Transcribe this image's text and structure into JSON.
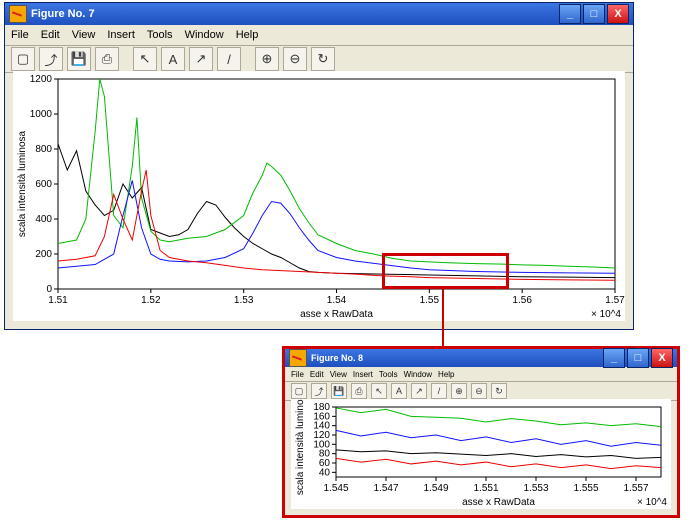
{
  "window_main": {
    "title": "Figure No. 7"
  },
  "window_zoom": {
    "title": "Figure No. 8"
  },
  "menu": {
    "file": "File",
    "edit": "Edit",
    "view": "View",
    "insert": "Insert",
    "tools": "Tools",
    "window": "Window",
    "help": "Help"
  },
  "toolbar_icons": [
    "new",
    "open",
    "save",
    "print",
    "arrow",
    "text",
    "line",
    "arrowline",
    "zoomin",
    "zoomout",
    "rotate"
  ],
  "titlebar_buttons": {
    "min": "_",
    "max": "□",
    "close": "X"
  },
  "chart_data": {
    "type": "line",
    "title": "",
    "xlabel": "asse x RawData",
    "ylabel": "scala intensità luminosa",
    "x_exponent": "× 10^4",
    "xlim": [
      1.51,
      1.57
    ],
    "ylim": [
      0,
      1200
    ],
    "xticks": [
      1.51,
      1.52,
      1.53,
      1.54,
      1.55,
      1.56,
      1.57
    ],
    "yticks": [
      0,
      200,
      400,
      600,
      800,
      1000,
      1200
    ],
    "highlight_x": [
      1.545,
      1.558
    ],
    "highlight_y": [
      30,
      200
    ],
    "series": [
      {
        "name": "black",
        "color": "#000",
        "x": [
          1.51,
          1.511,
          1.512,
          1.513,
          1.514,
          1.515,
          1.516,
          1.517,
          1.518,
          1.519,
          1.52,
          1.521,
          1.522,
          1.523,
          1.524,
          1.525,
          1.526,
          1.527,
          1.528,
          1.529,
          1.53,
          1.531,
          1.532,
          1.533,
          1.534,
          1.535,
          1.536,
          1.537,
          1.538,
          1.54,
          1.542,
          1.545,
          1.548,
          1.55,
          1.555,
          1.56,
          1.565,
          1.57
        ],
        "y": [
          830,
          680,
          790,
          560,
          480,
          420,
          450,
          600,
          520,
          580,
          340,
          320,
          300,
          310,
          340,
          430,
          500,
          480,
          410,
          350,
          300,
          260,
          230,
          200,
          180,
          150,
          120,
          100,
          95,
          90,
          88,
          85,
          82,
          80,
          75,
          70,
          68,
          65
        ]
      },
      {
        "name": "green",
        "color": "#0b0",
        "x": [
          1.51,
          1.512,
          1.513,
          1.514,
          1.5145,
          1.515,
          1.516,
          1.517,
          1.518,
          1.5185,
          1.519,
          1.52,
          1.521,
          1.522,
          1.524,
          1.526,
          1.528,
          1.53,
          1.531,
          1.532,
          1.5325,
          1.533,
          1.534,
          1.535,
          1.536,
          1.537,
          1.538,
          1.54,
          1.542,
          1.544,
          1.546,
          1.548,
          1.55,
          1.552,
          1.555,
          1.558,
          1.56,
          1.562,
          1.565,
          1.568,
          1.57
        ],
        "y": [
          260,
          280,
          400,
          900,
          1200,
          1100,
          420,
          350,
          700,
          980,
          520,
          330,
          280,
          270,
          290,
          300,
          340,
          420,
          550,
          650,
          720,
          700,
          650,
          560,
          460,
          380,
          310,
          260,
          220,
          200,
          175,
          160,
          155,
          150,
          145,
          142,
          138,
          136,
          130,
          125,
          120
        ]
      },
      {
        "name": "blue",
        "color": "#11f",
        "x": [
          1.51,
          1.512,
          1.514,
          1.516,
          1.517,
          1.518,
          1.519,
          1.52,
          1.521,
          1.522,
          1.524,
          1.526,
          1.528,
          1.53,
          1.531,
          1.532,
          1.533,
          1.534,
          1.535,
          1.536,
          1.537,
          1.538,
          1.54,
          1.542,
          1.545,
          1.548,
          1.55,
          1.555,
          1.56,
          1.565,
          1.57
        ],
        "y": [
          120,
          130,
          140,
          200,
          420,
          620,
          350,
          200,
          170,
          160,
          155,
          160,
          180,
          230,
          320,
          420,
          500,
          490,
          430,
          350,
          280,
          220,
          180,
          160,
          140,
          120,
          110,
          100,
          95,
          92,
          90
        ]
      },
      {
        "name": "red",
        "color": "#e00",
        "x": [
          1.51,
          1.512,
          1.514,
          1.515,
          1.516,
          1.517,
          1.518,
          1.519,
          1.5195,
          1.52,
          1.521,
          1.522,
          1.524,
          1.526,
          1.528,
          1.53,
          1.532,
          1.534,
          1.536,
          1.538,
          1.54,
          1.542,
          1.545,
          1.548,
          1.55,
          1.555,
          1.56,
          1.565,
          1.57
        ],
        "y": [
          160,
          170,
          190,
          300,
          540,
          400,
          280,
          560,
          680,
          420,
          220,
          180,
          160,
          150,
          135,
          120,
          110,
          105,
          100,
          95,
          90,
          85,
          75,
          70,
          65,
          60,
          55,
          52,
          50
        ]
      }
    ]
  },
  "zoom_chart": {
    "type": "line",
    "xlabel": "asse x RawData",
    "ylabel": "scala intensità luminosa",
    "x_exponent": "× 10^4",
    "xlim": [
      1.545,
      1.558
    ],
    "ylim": [
      30,
      180
    ],
    "xticks": [
      1.545,
      1.547,
      1.549,
      1.551,
      1.553,
      1.555,
      1.557
    ],
    "yticks": [
      40,
      60,
      80,
      100,
      120,
      140,
      160,
      180
    ],
    "series": [
      {
        "name": "green",
        "color": "#0b0",
        "x": [
          1.545,
          1.546,
          1.547,
          1.548,
          1.549,
          1.55,
          1.551,
          1.552,
          1.553,
          1.554,
          1.555,
          1.556,
          1.557,
          1.558
        ],
        "y": [
          178,
          168,
          175,
          160,
          158,
          156,
          148,
          155,
          150,
          142,
          146,
          140,
          144,
          138
        ]
      },
      {
        "name": "black",
        "color": "#000",
        "x": [
          1.545,
          1.546,
          1.547,
          1.548,
          1.549,
          1.55,
          1.551,
          1.552,
          1.553,
          1.554,
          1.555,
          1.556,
          1.557,
          1.558
        ],
        "y": [
          88,
          84,
          86,
          80,
          82,
          79,
          76,
          80,
          74,
          78,
          73,
          76,
          70,
          72
        ]
      },
      {
        "name": "blue",
        "color": "#11f",
        "x": [
          1.545,
          1.546,
          1.547,
          1.548,
          1.549,
          1.55,
          1.551,
          1.552,
          1.553,
          1.554,
          1.555,
          1.556,
          1.557,
          1.558
        ],
        "y": [
          130,
          118,
          126,
          114,
          120,
          108,
          116,
          104,
          112,
          100,
          108,
          96,
          104,
          98
        ]
      },
      {
        "name": "red",
        "color": "#e00",
        "x": [
          1.545,
          1.546,
          1.547,
          1.548,
          1.549,
          1.55,
          1.551,
          1.552,
          1.553,
          1.554,
          1.555,
          1.556,
          1.557,
          1.558
        ],
        "y": [
          70,
          62,
          68,
          58,
          64,
          56,
          62,
          52,
          58,
          50,
          56,
          48,
          54,
          50
        ]
      }
    ]
  }
}
